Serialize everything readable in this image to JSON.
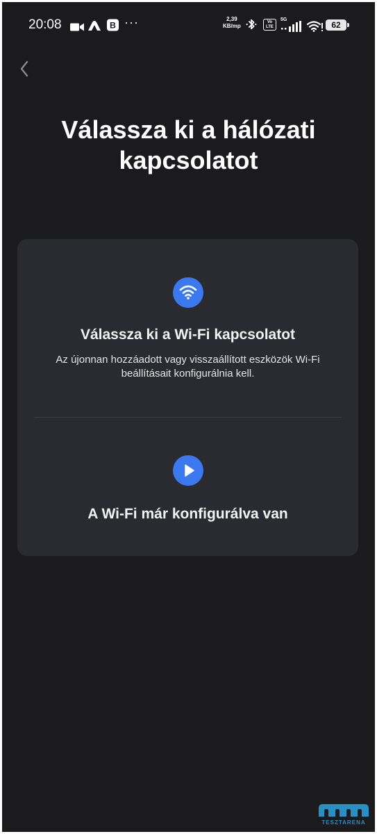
{
  "status_bar": {
    "time": "20:08",
    "icons": [
      "video-camera-icon",
      "cloud-icon",
      "b-badge-icon",
      "more-dots-icon",
      "bluetooth-icon",
      "volte-icon",
      "signal-icon",
      "wifi-icon",
      "battery-icon"
    ],
    "more": "···",
    "speed_value": "2,39",
    "speed_unit": "KB/mp",
    "volte_top": "Vo",
    "volte_bottom": "LTE",
    "network": "5G",
    "battery_level": "62"
  },
  "header": {
    "back_icon": "chevron-left-icon",
    "title": "Válassza ki a hálózati kapcsolatot"
  },
  "options": {
    "wifi_setup": {
      "icon": "wifi-icon",
      "title": "Válassza ki a Wi-Fi kapcsolatot",
      "description": "Az újonnan hozzáadott vagy visszaállított eszközök Wi-Fi beállításait konfigurálnia kell."
    },
    "already_configured": {
      "icon": "play-icon",
      "title": "A Wi-Fi már konfigurálva van"
    }
  },
  "watermark": {
    "text": "TESZTARENA"
  },
  "colors": {
    "background": "#1b1b1d",
    "card": "#2a2b30",
    "accent": "#3c78f0",
    "watermark": "#2a8fc4"
  }
}
